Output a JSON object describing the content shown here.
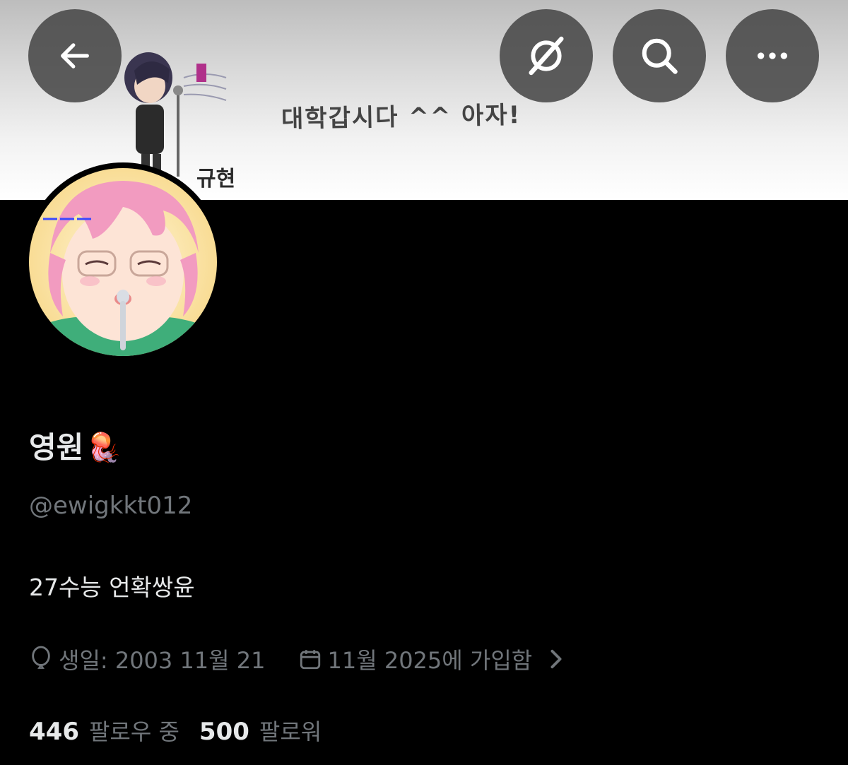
{
  "banner": {
    "caption": "대학갑시다 ^^ 아자!",
    "name_tag": "규현"
  },
  "header": {
    "back_icon": "arrow-left-icon",
    "grok_icon": "slash-circle-icon",
    "search_icon": "search-icon",
    "more_icon": "more-horizontal-icon"
  },
  "profile": {
    "display_name": "영원",
    "name_emoji": "🪼",
    "handle": "@ewigkkt012",
    "bio": "27수능 언확쌍윤",
    "birthday": "생일: 2003 11월 21",
    "joined": "11월 2025에 가입함",
    "following_count": "446",
    "following_label": "팔로우 중",
    "followers_count": "500",
    "followers_label": "팔로워"
  },
  "colors": {
    "background": "#000000",
    "text_primary": "#e7e9ea",
    "text_secondary": "#71767b",
    "header_button": "#484848"
  }
}
